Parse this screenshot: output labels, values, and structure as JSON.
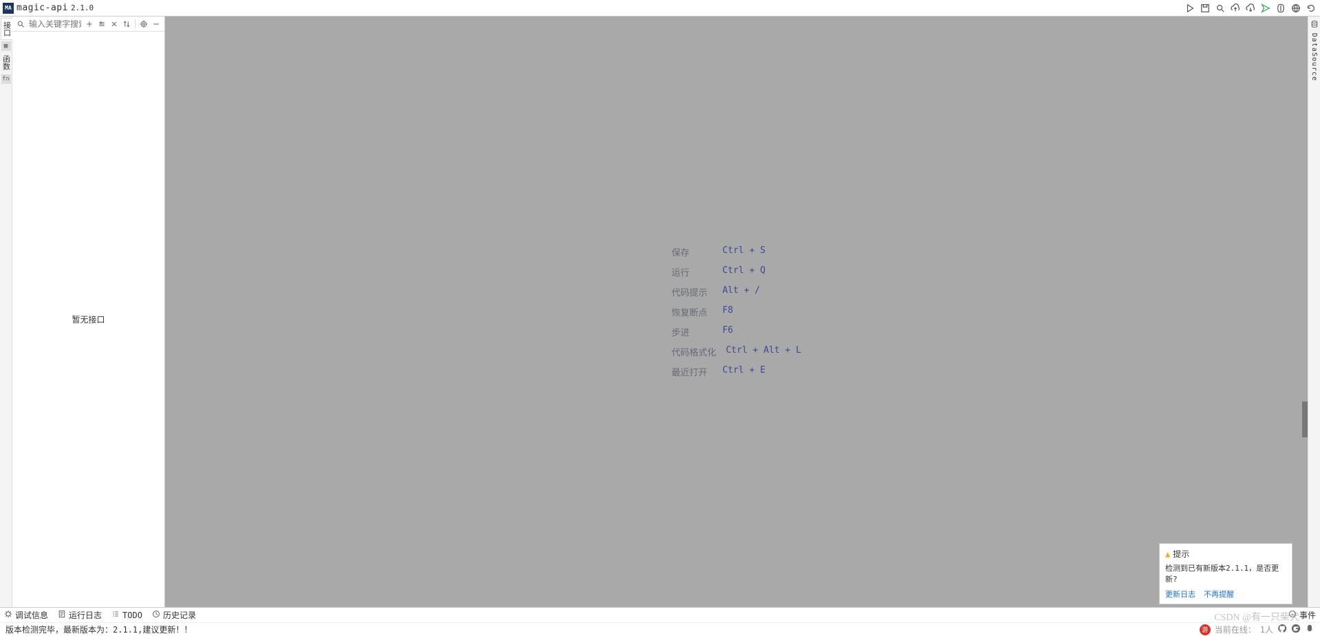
{
  "header": {
    "logo_text": "MA",
    "title": "magic-api",
    "version": "2.1.0"
  },
  "leftstrip": {
    "tabs": [
      {
        "label": "接口",
        "icon": "api-icon"
      },
      {
        "label": "函数",
        "icon": "fn-icon"
      }
    ]
  },
  "sidebar": {
    "search_placeholder": "输入关键字搜索",
    "empty_text": "暂无接口"
  },
  "editor_hints": [
    {
      "label": "保存",
      "key": "Ctrl + S"
    },
    {
      "label": "运行",
      "key": "Ctrl + Q"
    },
    {
      "label": "代码提示",
      "key": "Alt + /"
    },
    {
      "label": "恢复断点",
      "key": "F8"
    },
    {
      "label": "步进",
      "key": "F6"
    },
    {
      "label": "代码格式化",
      "key": "Ctrl + Alt + L"
    },
    {
      "label": "最近打开",
      "key": "Ctrl + E"
    }
  ],
  "rightstrip": {
    "label": "DataSource"
  },
  "notification": {
    "title": "提示",
    "body": "检测到已有新版本2.1.1，是否更新?",
    "actions": {
      "changelog": "更新日志",
      "dismiss": "不再提醒"
    }
  },
  "bottom_tabs": {
    "items": [
      {
        "icon": "debug-icon",
        "label": "调试信息"
      },
      {
        "icon": "log-icon",
        "label": "运行日志"
      },
      {
        "icon": "todo-icon",
        "label": "TODO"
      },
      {
        "icon": "history-icon",
        "label": "历史记录"
      }
    ],
    "right": {
      "icon": "info-icon",
      "label": "事件"
    }
  },
  "status": {
    "message": "版本检测完毕，最新版本为：2.1.1,建议更新！！",
    "badge_text": "游",
    "online_label": "当前在线：",
    "online_count": "1人"
  },
  "watermark": "CSDN @有一只柴犬"
}
